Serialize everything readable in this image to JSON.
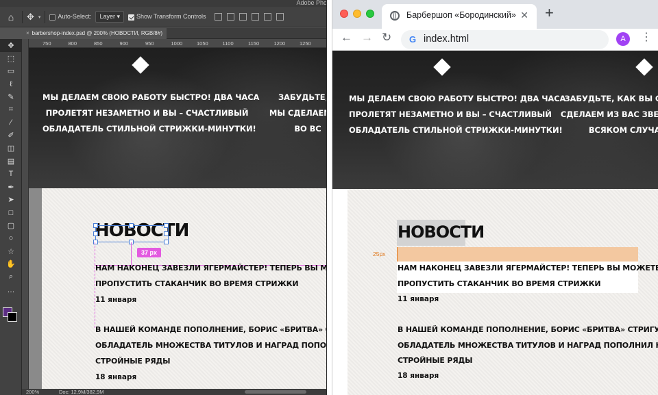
{
  "photoshop": {
    "app_title": "Adobe Pho",
    "options": {
      "auto_select_label": "Auto-Select:",
      "layer_select": "Layer",
      "transform_controls_label": "Show Transform Controls"
    },
    "doc_tab": "barbershop-index.psd @ 200% (НОВОСТИ, RGB/8#)",
    "ruler_ticks": [
      "750",
      "800",
      "850",
      "900",
      "950",
      "1000",
      "1050",
      "1100",
      "1150",
      "1200",
      "1250"
    ],
    "measure_label": "37 px",
    "zoom": "200%",
    "doc_size": "Doc: 12,9M/382,9M",
    "tool_icons": [
      "move-icon",
      "artboard-icon",
      "marquee-icon",
      "lasso-icon",
      "quick-select-icon",
      "crop-icon",
      "eyedropper-icon",
      "brush-icon",
      "eraser-icon",
      "gradient-icon",
      "type-icon",
      "pen-icon",
      "path-select-icon",
      "rectangle-icon",
      "rounded-rect-icon",
      "ellipse-icon",
      "custom-shape-icon",
      "hand-icon",
      "zoom-icon",
      "more-icon"
    ],
    "foreground_color": "#5b2c83",
    "background_color": "#000000"
  },
  "browser": {
    "tab_title": "Барбершоп «Бородинский»",
    "url": "index.html",
    "avatar_letter": "A",
    "margin_label": "25px"
  },
  "page": {
    "hero_left": [
      "МЫ ДЕЛАЕМ СВОЮ РАБОТУ БЫСТРО! ДВА ЧАСА",
      "ПРОЛЕТЯТ НЕЗАМЕТНО И ВЫ – СЧАСТЛИВЫЙ",
      "ОБЛАДАТЕЛЬ СТИЛЬНОЙ СТРИЖКИ-МИНУТКИ!"
    ],
    "hero_right_ps": [
      "ЗАБУДЬТЕ, К",
      "МЫ СДЕЛАЕМ ИЗ",
      "ВО ВС"
    ],
    "hero_right_br": [
      "ЗАБУДЬТЕ, КАК ВЫ СТРИГЛ",
      "СДЕЛАЕМ ИЗ ВАС ЗВЕЗДУ ФУ",
      "ВСЯКОМ СЛУЧАЕ"
    ],
    "news_heading": "НОВОСТИ",
    "news": [
      {
        "lines": [
          "НАМ НАКОНЕЦ ЗАВЕЗЛИ ЯГЕРМАЙСТЕР! ТЕПЕРЬ ВЫ МОЖЕТЕ",
          "ПРОПУСТИТЬ СТАКАНЧИК ВО ВРЕМЯ СТРИЖКИ"
        ],
        "date": "11 января"
      },
      {
        "lines": [
          "В НАШЕЙ КОМАНДЕ ПОПОЛНЕНИЕ, БОРИС «БРИТВА» СТРИГУНЕЦ,",
          "ОБЛАДАТЕЛЬ МНОЖЕСТВА ТИТУЛОВ И НАГРАД ПОПОЛНИЛ НАШИ",
          "СТРОЙНЫЕ РЯДЫ"
        ],
        "date": "18 января"
      }
    ]
  }
}
